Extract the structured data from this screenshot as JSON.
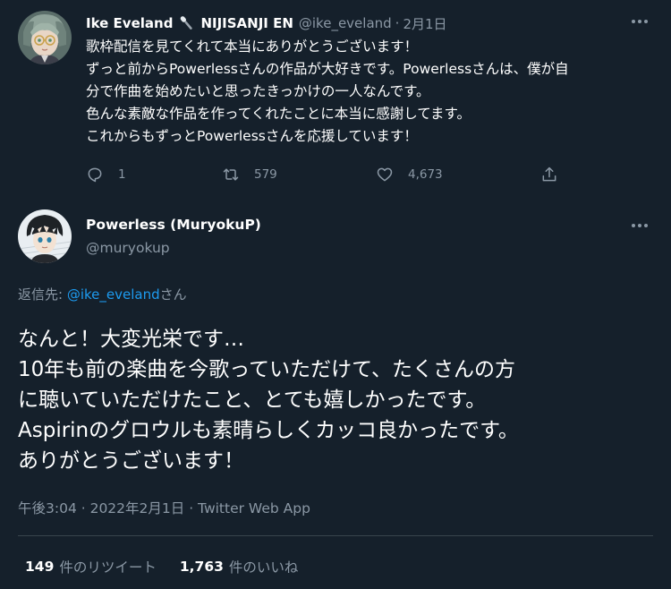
{
  "colors": {
    "background": "#15202b",
    "text_primary": "#ffffff",
    "text_secondary": "#8b98a5",
    "link": "#1d9bf0",
    "divider": "#38444d"
  },
  "parent_tweet": {
    "display_name": "Ike Eveland",
    "name_icon": "microphone-icon",
    "name_suffix": "NIJISANJI EN",
    "handle": "@ike_eveland",
    "separator": "·",
    "time": "2月1日",
    "more_icon": "more-options-icon",
    "lines": [
      "歌枠配信を見てくれて本当にありがとうございます！",
      "ずっと前からPowerlessさんの作品が大好きです。Powerlessさんは、僕が自",
      "分で作曲を始めたいと思ったきっかけの一人なんです。",
      "色んな素敵な作品を作ってくれたことに本当に感謝してます。",
      "これからもずっとPowerlessさんを応援しています！"
    ],
    "actions": {
      "reply_count": "1",
      "retweet_count": "579",
      "like_count": "4,673"
    }
  },
  "main_tweet": {
    "display_name": "Powerless (MuryokuP)",
    "handle": "@muryokup",
    "replying_prefix": "返信先: ",
    "replying_mention": "@ike_eveland",
    "replying_suffix": "さん",
    "lines": [
      "なんと！大変光栄です…",
      "10年も前の楽曲を今歌っていただけて、たくさんの方",
      "に聴いていただけたこと、とても嬉しかったです。",
      "Aspirinのグロウルも素晴らしくカッコ良かったです。",
      "ありがとうございます！"
    ],
    "timestamp": "午後3:04 · 2022年2月1日",
    "meta_separator": " · ",
    "source": "Twitter Web App",
    "retweet_stat_count": "149",
    "retweet_stat_label": "件のリツイート",
    "like_stat_count": "1,763",
    "like_stat_label": "件のいいね"
  }
}
